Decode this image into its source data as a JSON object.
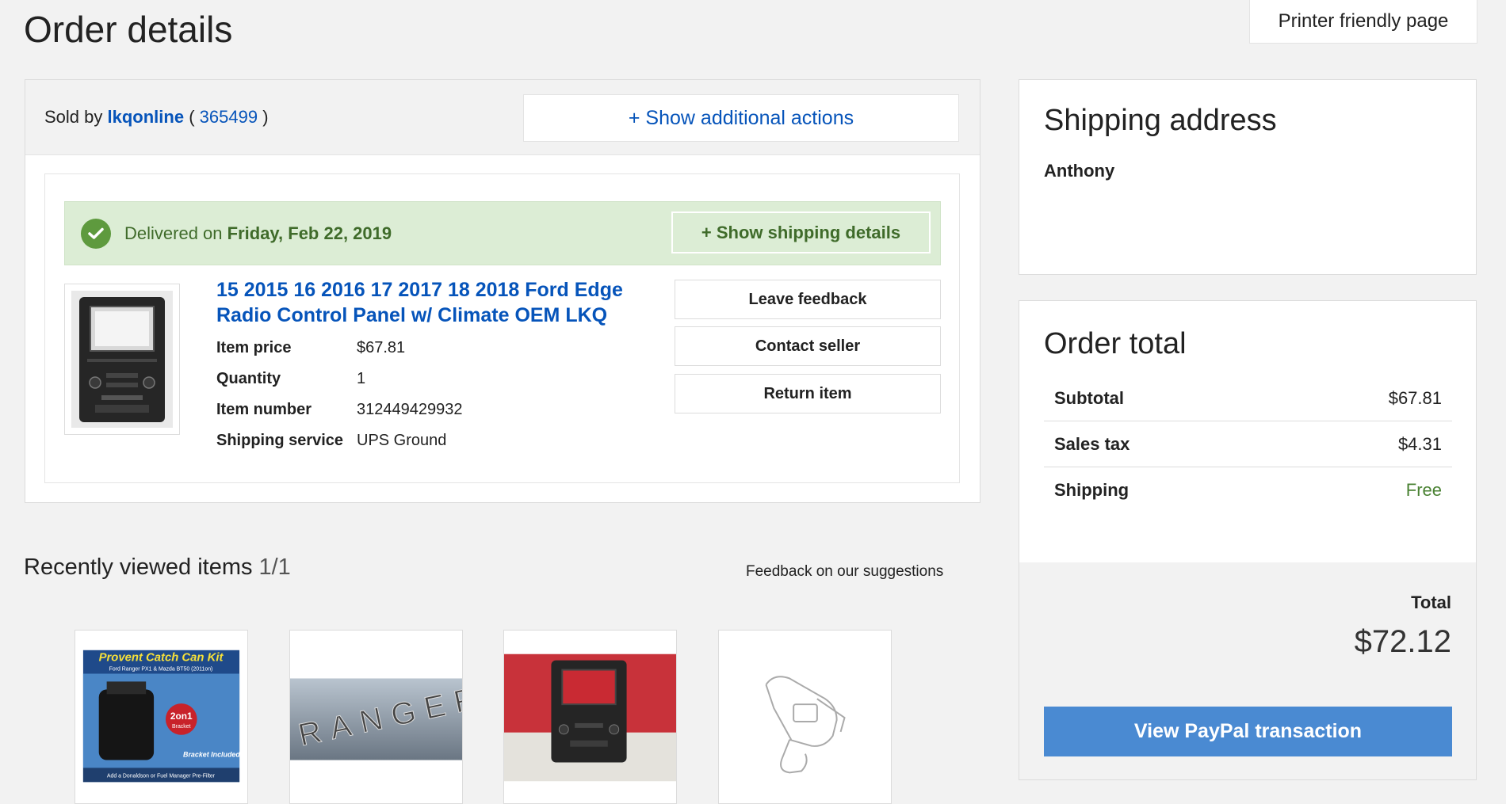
{
  "page": {
    "title": "Order details",
    "printer_label": "Printer friendly page"
  },
  "order": {
    "sold_by_prefix": "Sold by",
    "seller_name": "lkqonline",
    "seller_score": "365499",
    "show_actions_label": "+ Show additional actions",
    "delivered_prefix": "Delivered on",
    "delivered_date": "Friday, Feb 22, 2019",
    "show_shipping_label": "+ Show shipping details",
    "item_title": "15 2015 16 2016 17 2017 18 2018 Ford Edge Radio Control Panel w/ Climate OEM LKQ",
    "specs": [
      {
        "label": "Item price",
        "value": "$67.81"
      },
      {
        "label": "Quantity",
        "value": "1"
      },
      {
        "label": "Item number",
        "value": "312449429932"
      },
      {
        "label": "Shipping service",
        "value": "UPS Ground"
      }
    ],
    "actions": [
      "Leave feedback",
      "Contact seller",
      "Return item"
    ]
  },
  "shipping": {
    "title": "Shipping address",
    "name": "Anthony"
  },
  "totals": {
    "title": "Order total",
    "rows": [
      {
        "label": "Subtotal",
        "value": "$67.81"
      },
      {
        "label": "Sales tax",
        "value": "$4.31"
      },
      {
        "label": "Shipping",
        "value": "Free"
      }
    ],
    "total_label": "Total",
    "total_value": "$72.12",
    "paypal_label": "View PayPal transaction"
  },
  "recent": {
    "title": "Recently viewed items",
    "count": "1/1",
    "feedback_label": "Feedback on our suggestions",
    "item1_title": "Provent Catch Can Kit",
    "item1_subtitle": "Ford Ranger PX1 & Mazda BT50 (2011on)",
    "item1_badge": "2on1",
    "item1_badge_sub": "Bracket",
    "item1_footer": "Bracket Included!",
    "item1_footer2": "Add a Donaldson or Fuel Manager Pre-Filter",
    "item2_text": "RANGER"
  },
  "colors": {
    "link": "#0654ba",
    "delivered_bg": "#dcedd5",
    "delivered_text": "#3f6b2a",
    "paypal_button": "#4a8ad2",
    "free_text": "#4a8233"
  },
  "icons": {
    "delivered": "check-circle-icon"
  }
}
